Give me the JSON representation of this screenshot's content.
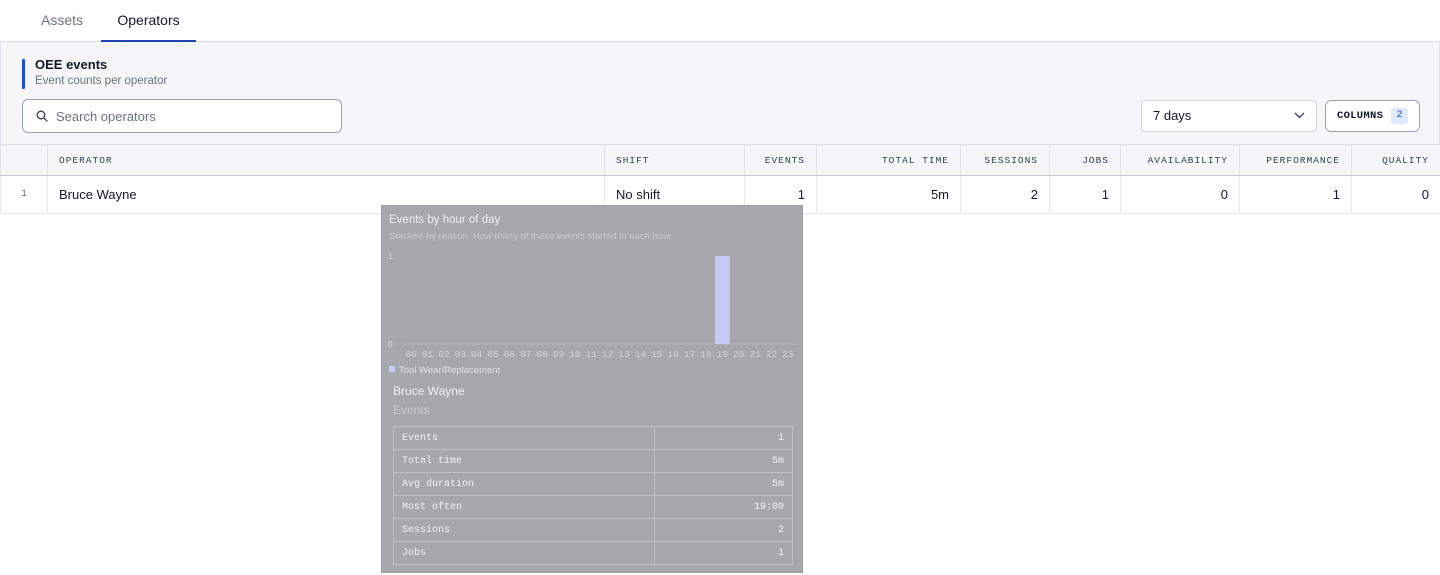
{
  "tabs": [
    {
      "label": "Assets",
      "active": false
    },
    {
      "label": "Operators",
      "active": true
    }
  ],
  "panel": {
    "title": "OEE events",
    "subtitle": "Event counts per operator"
  },
  "search": {
    "placeholder": "Search operators",
    "value": ""
  },
  "range_select": {
    "value": "7 days"
  },
  "columns_button": {
    "label": "COLUMNS",
    "badge": "2"
  },
  "table": {
    "headers": {
      "operator": "OPERATOR",
      "shift": "SHIFT",
      "events": "EVENTS",
      "total_time": "TOTAL TIME",
      "sessions": "SESSIONS",
      "jobs": "JOBS",
      "availability": "AVAILABILITY",
      "performance": "PERFORMANCE",
      "quality": "QUALITY"
    },
    "rows": [
      {
        "index": "1",
        "operator": "Bruce Wayne",
        "shift": "No shift",
        "events": "1",
        "total_time": "5m",
        "sessions": "2",
        "jobs": "1",
        "availability": "0",
        "performance": "1",
        "quality": "0"
      }
    ]
  },
  "popover": {
    "title": "Events by hour of day",
    "subtitle": "Stacked by reason. How many of these events started in each hour",
    "operator": "Bruce Wayne",
    "kind": "Events",
    "stats": [
      {
        "label": "Events",
        "value": "1"
      },
      {
        "label": "Total time",
        "value": "5m"
      },
      {
        "label": "Avg duration",
        "value": "5m"
      },
      {
        "label": "Most often",
        "value": "19:00"
      },
      {
        "label": "Sessions",
        "value": "2"
      },
      {
        "label": "Jobs",
        "value": "1"
      }
    ]
  },
  "colors": {
    "accent": "#1d4ed8",
    "bar": "#c6c8f5"
  },
  "chart_data": {
    "type": "bar",
    "title": "Events by hour of day",
    "subtitle": "Stacked by reason. How many of these events started in each hour",
    "categories": [
      "00",
      "01",
      "02",
      "03",
      "04",
      "05",
      "06",
      "07",
      "08",
      "09",
      "10",
      "11",
      "12",
      "13",
      "14",
      "15",
      "16",
      "17",
      "18",
      "19",
      "20",
      "21",
      "22",
      "23"
    ],
    "series": [
      {
        "name": "Tool Wear/Replacement",
        "values": [
          0,
          0,
          0,
          0,
          0,
          0,
          0,
          0,
          0,
          0,
          0,
          0,
          0,
          0,
          0,
          0,
          0,
          0,
          0,
          1,
          0,
          0,
          0,
          0
        ]
      }
    ],
    "ylim": [
      0,
      1
    ],
    "yticks": [
      "0",
      "1"
    ],
    "legend": "bottom-left",
    "grid": false
  }
}
